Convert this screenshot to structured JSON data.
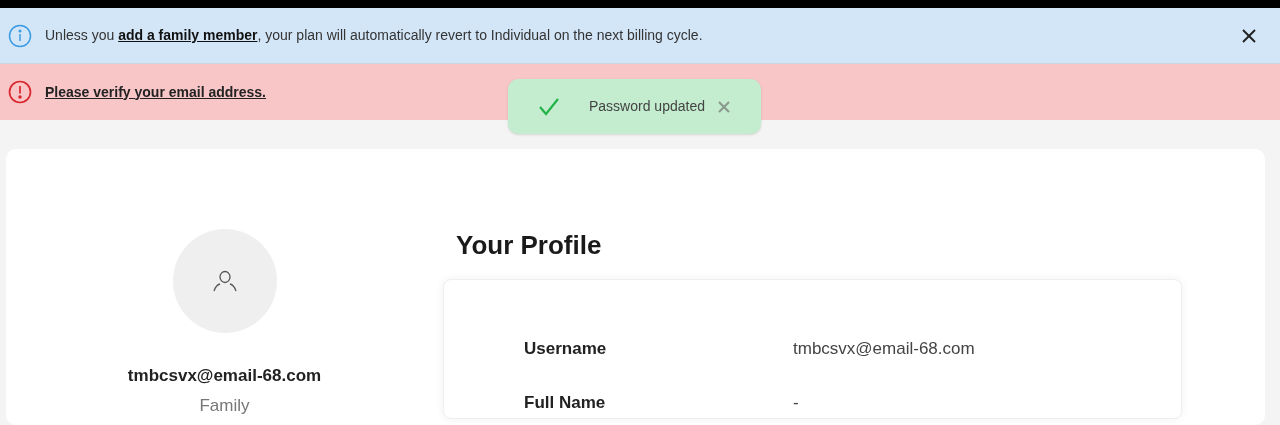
{
  "info_banner": {
    "message": "Unless you **add a family member**, your plan will automatically revert to Individual on the next billing cycle."
  },
  "error_banner": {
    "message": "Please verify your email address."
  },
  "toast": {
    "message": "Password updated"
  },
  "profile": {
    "username": "tmbcsvx@email-68.com",
    "plan": "Family",
    "heading": "Your Profile",
    "fields": [
      {
        "label": "Username",
        "value": "tmbcsvx@email-68.com"
      },
      {
        "label": "Full Name",
        "value": "-"
      }
    ]
  }
}
